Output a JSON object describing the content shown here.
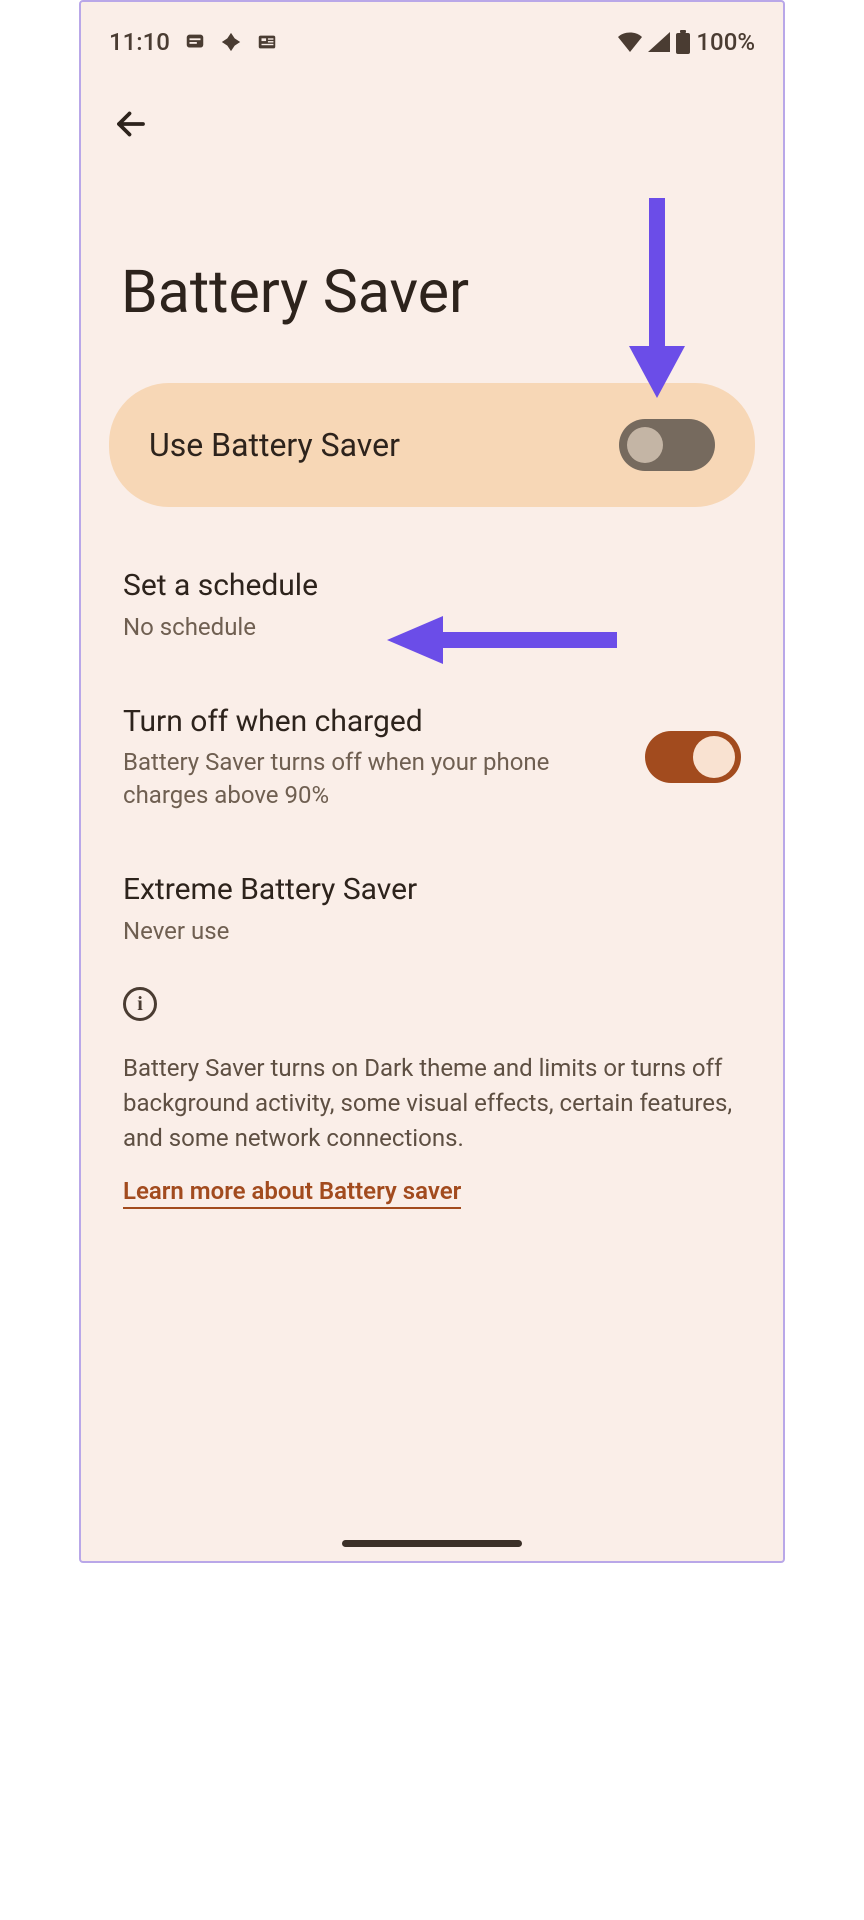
{
  "status": {
    "time": "11:10",
    "battery_text": "100%"
  },
  "page": {
    "title": "Battery Saver"
  },
  "primary": {
    "label": "Use Battery Saver",
    "state": "off"
  },
  "settings": {
    "schedule": {
      "title": "Set a schedule",
      "sub": "No schedule"
    },
    "turn_off": {
      "title": "Turn off when charged",
      "sub": "Battery Saver turns off when your phone charges above 90%",
      "state": "on"
    },
    "extreme": {
      "title": "Extreme Battery Saver",
      "sub": "Never use"
    }
  },
  "info": {
    "text": "Battery Saver turns on Dark theme and limits or turns off background activity, some visual effects, certain features, and some network connections.",
    "link": "Learn more about Battery saver"
  },
  "annotations": {
    "color": "#6b4de8"
  }
}
